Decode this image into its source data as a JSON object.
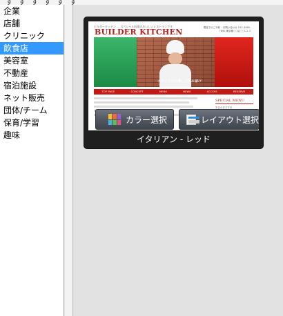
{
  "top_fragment": "す す す す す す",
  "sidebar": {
    "items": [
      {
        "label": "企業",
        "selected": false
      },
      {
        "label": "店舗",
        "selected": false
      },
      {
        "label": "クリニック",
        "selected": false
      },
      {
        "label": "飲食店",
        "selected": true
      },
      {
        "label": "美容室",
        "selected": false
      },
      {
        "label": "不動産",
        "selected": false
      },
      {
        "label": "宿泊施設",
        "selected": false
      },
      {
        "label": "ネット販売",
        "selected": false
      },
      {
        "label": "団体/チーム",
        "selected": false
      },
      {
        "label": "保育/学習",
        "selected": false
      },
      {
        "label": "趣味",
        "selected": false
      }
    ]
  },
  "template": {
    "name": "イタリアン - レッド",
    "color_button": "カラー選択",
    "layout_button": "レイアウト選択",
    "preview": {
      "brand": "BUILDER KITCHEN",
      "tagline": "ビルダーキッチン … スペシャル料理のおいしいレストランです",
      "contact": "電話でのご予約・お問い合わせ 012-3456-7890 東京都○○区○○1-2-3",
      "caption": "イタリアンの楽しさをお届け",
      "nav": [
        "TOP PAGE",
        "CONCEPT",
        "MENU",
        "NEWS",
        "ACCESS",
        "RESERVE"
      ],
      "special_title": "SPECIAL MENU",
      "special_text": "本日のおすすめ"
    }
  },
  "colors": {
    "selection": "#3399ff",
    "brand_red": "#b2201c",
    "hero_green": "#1c8a45",
    "hero_red": "#c21a16",
    "card_bg": "#1f1f1f"
  },
  "icons": {
    "color_button_icon": "color-palette-icon",
    "layout_button_icon": "layout-icon"
  }
}
